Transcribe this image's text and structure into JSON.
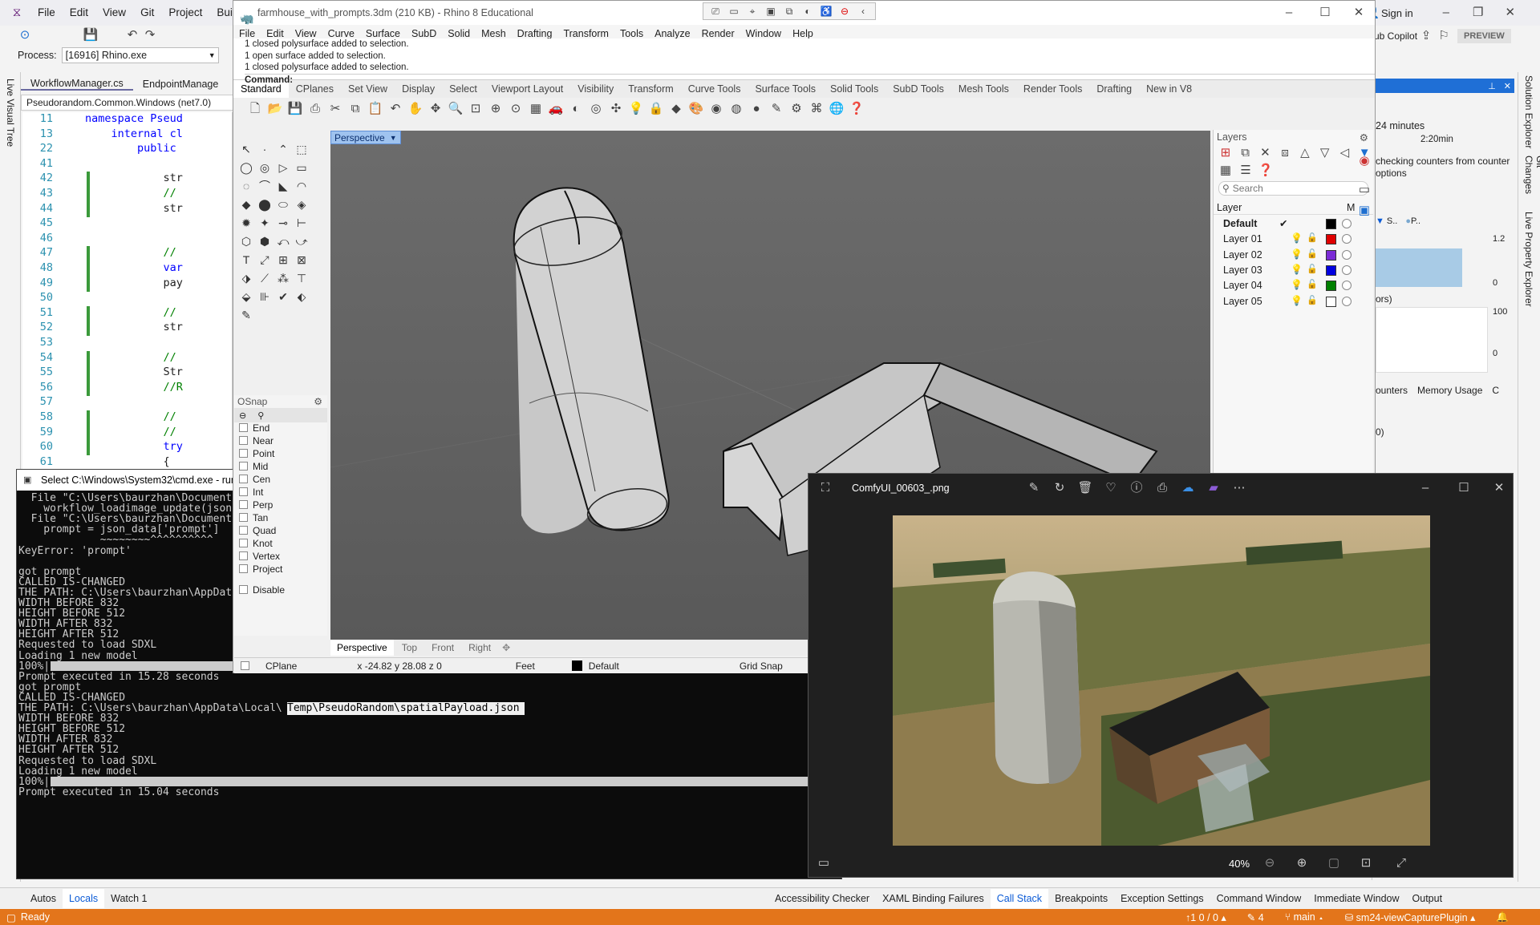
{
  "vs": {
    "menu": [
      "File",
      "Edit",
      "View",
      "Git",
      "Project",
      "Build"
    ],
    "process_label": "Process:",
    "process_value": "[16916] Rhino.exe",
    "tabs": [
      "WorkflowManager.cs",
      "EndpointManage"
    ],
    "context": "Pseudorandom.Common.Windows (net7.0)",
    "left_strip": "Live Visual Tree",
    "sign_in": "Sign in",
    "copilot": "ub Copilot",
    "preview": "PREVIEW",
    "code": [
      {
        "n": "11",
        "t": "namespace Pseud"
      },
      {
        "n": "13",
        "t": "    internal cl"
      },
      {
        "n": "22",
        "t": "        public "
      },
      {
        "n": "41",
        "t": ""
      },
      {
        "n": "42",
        "t": "            str"
      },
      {
        "n": "43",
        "t": "            //"
      },
      {
        "n": "44",
        "t": "            str"
      },
      {
        "n": "45",
        "t": ""
      },
      {
        "n": "46",
        "t": ""
      },
      {
        "n": "47",
        "t": "            //"
      },
      {
        "n": "48",
        "t": "            var"
      },
      {
        "n": "49",
        "t": "            pay"
      },
      {
        "n": "50",
        "t": ""
      },
      {
        "n": "51",
        "t": "            //"
      },
      {
        "n": "52",
        "t": "            str"
      },
      {
        "n": "53",
        "t": ""
      },
      {
        "n": "54",
        "t": "            //"
      },
      {
        "n": "55",
        "t": "            Str"
      },
      {
        "n": "56",
        "t": "            //R"
      },
      {
        "n": "57",
        "t": ""
      },
      {
        "n": "58",
        "t": "            //"
      },
      {
        "n": "59",
        "t": "            //"
      },
      {
        "n": "60",
        "t": "            try"
      },
      {
        "n": "61",
        "t": "            {"
      }
    ],
    "diag": {
      "time": "24 minutes",
      "timer": "2:20min",
      "desc": "checking counters from counter options",
      "legend": [
        "S..",
        "P.."
      ],
      "y1": "1.2",
      "y0": "0",
      "ors": "ors)",
      "y100": "100",
      "y0b": "0",
      "tabs": [
        "ounters",
        "Memory Usage",
        "C"
      ],
      "zero": "0)"
    },
    "right_strip": [
      "Solution Explorer",
      "Git Changes",
      "Live Property Explorer"
    ],
    "bottom_left_tabs": [
      "Autos",
      "Locals",
      "Watch 1"
    ],
    "bottom_right_tabs": [
      "Accessibility Checker",
      "XAML Binding Failures",
      "Call Stack",
      "Breakpoints",
      "Exception Settings",
      "Command Window",
      "Immediate Window",
      "Output"
    ],
    "status": {
      "ready": "Ready",
      "updown": "↑1 0 / 0 ▴",
      "pen": "4",
      "branch": "main",
      "repo": "sm24-viewCapturePlugin"
    }
  },
  "cmd": {
    "title": "Select C:\\Windows\\System32\\cmd.exe - run_",
    "lines": [
      "  File \"C:\\Users\\baurzhan\\Document",
      "    workflow_loadimage_update(json",
      "  File \"C:\\Users\\baurzhan\\Document",
      "    prompt = json_data['prompt']",
      "             ~~~~~~~~^^^^^^^^^^",
      "KeyError: 'prompt'",
      "",
      "got prompt",
      "CALLED IS-CHANGED",
      "THE PATH: C:\\Users\\baurzhan\\AppDat",
      "WIDTH BEFORE 832",
      "HEIGHT BEFORE 512",
      "WIDTH AFTER 832",
      "HEIGHT AFTER 512",
      "Requested to load SDXL",
      "Loading 1 new model",
      "100%|",
      "Prompt executed in 15.28 seconds",
      "got prompt",
      "CALLED IS-CHANGED",
      "THE PATH: C:\\Users\\baurzhan\\AppData\\Local\\",
      "WIDTH BEFORE 832",
      "HEIGHT BEFORE 512",
      "WIDTH AFTER 832",
      "HEIGHT AFTER 512",
      "Requested to load SDXL",
      "Loading 1 new model",
      "100%|",
      "Prompt executed in 15.04 seconds"
    ],
    "selection": "Temp\\PseudoRandom\\spatialPayload.json"
  },
  "rhino": {
    "title": "farmhouse_with_prompts.3dm (210 KB) - Rhino 8 Educational",
    "menu": [
      "File",
      "Edit",
      "View",
      "Curve",
      "Surface",
      "SubD",
      "Solid",
      "Mesh",
      "Drafting",
      "Transform",
      "Tools",
      "Analyze",
      "Render",
      "Window",
      "Help"
    ],
    "history": [
      "1 closed polysurface added to selection.",
      "1 open surface added to selection.",
      "1 closed polysurface added to selection."
    ],
    "command_label": "Command:",
    "tabs": [
      "Standard",
      "CPlanes",
      "Set View",
      "Display",
      "Select",
      "Viewport Layout",
      "Visibility",
      "Transform",
      "Curve Tools",
      "Surface Tools",
      "Solid Tools",
      "SubD Tools",
      "Mesh Tools",
      "Render Tools",
      "Drafting",
      "New in V8"
    ],
    "viewport_label": "Perspective",
    "view_tabs": [
      "Perspective",
      "Top",
      "Front",
      "Right"
    ],
    "osnap_title": "OSnap",
    "osnap": [
      "End",
      "Near",
      "Point",
      "Mid",
      "Cen",
      "Int",
      "Perp",
      "Tan",
      "Quad",
      "Knot",
      "Vertex",
      "Project"
    ],
    "osnap_disable": "Disable",
    "status": {
      "cplane": "CPlane",
      "coords": "x -24.82  y 28.08  z 0",
      "units": "Feet",
      "layer": "Default",
      "grid": "Grid Snap"
    },
    "layers_title": "Layers",
    "layers_search": "Search",
    "layers_header": {
      "layer": "Layer",
      "m": "M"
    },
    "layers": [
      {
        "name": "Default",
        "color": "#000000",
        "current": true
      },
      {
        "name": "Layer 01",
        "color": "#e00000",
        "current": false
      },
      {
        "name": "Layer 02",
        "color": "#7b2bd6",
        "current": false
      },
      {
        "name": "Layer 03",
        "color": "#0000e0",
        "current": false
      },
      {
        "name": "Layer 04",
        "color": "#008000",
        "current": false
      },
      {
        "name": "Layer 05",
        "color": "#ffffff",
        "current": false
      }
    ]
  },
  "photos": {
    "filename": "ComfyUI_00603_.png",
    "zoom": "40%"
  }
}
